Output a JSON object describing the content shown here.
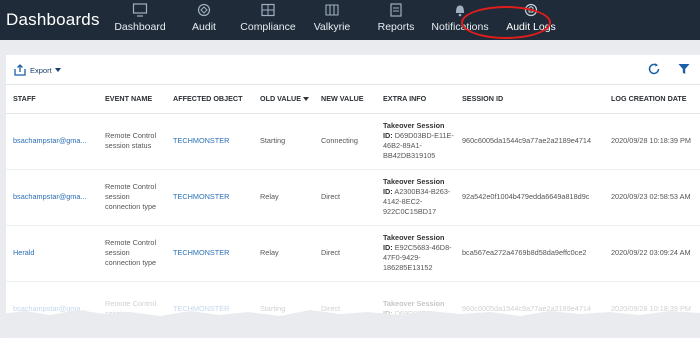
{
  "app": {
    "title": "Dashboards"
  },
  "nav": [
    {
      "label": "Dashboard",
      "icon": "monitor-icon"
    },
    {
      "label": "Audit",
      "icon": "audit-icon"
    },
    {
      "label": "Compliance",
      "icon": "compliance-icon"
    },
    {
      "label": "Valkyrie",
      "icon": "valkyrie-icon"
    },
    {
      "label": "Reports",
      "icon": "reports-icon"
    },
    {
      "label": "Notifications",
      "icon": "bell-icon"
    },
    {
      "label": "Audit Logs",
      "icon": "audit-logs-icon"
    }
  ],
  "toolbar": {
    "export_label": "Export"
  },
  "table": {
    "headers": [
      "STAFF",
      "EVENT NAME",
      "AFFECTED OBJECT",
      "OLD VALUE",
      "NEW VALUE",
      "EXTRA INFO",
      "SESSION ID",
      "LOG CREATION DATE"
    ],
    "rows": [
      {
        "staff": "bsachampstar@gma...",
        "event": "Remote Control session status",
        "object": "TECHMONSTER",
        "old": "Starting",
        "new": "Connecting",
        "extra_title": "Takeover Session",
        "extra_id_label": "ID:",
        "extra_id": "D69D03BD-E11E-46B2-89A1-BB42DB319105",
        "session": "960c6005da1544c9a77ae2a2189e4714",
        "date": "2020/09/28 10:18:39 PM"
      },
      {
        "staff": "bsachampstar@gma...",
        "event": "Remote Control session connection type",
        "object": "TECHMONSTER",
        "old": "Relay",
        "new": "Direct",
        "extra_title": "Takeover Session",
        "extra_id_label": "ID:",
        "extra_id": "A2300B34-B263-4142-8EC2-922C0C15BD17",
        "session": "92a542e0f1004b479edda6649a818d9c",
        "date": "2020/09/23 02:58:53 AM"
      },
      {
        "staff": "Herald",
        "event": "Remote Control session connection type",
        "object": "TECHMONSTER",
        "old": "Relay",
        "new": "Direct",
        "extra_title": "Takeover Session",
        "extra_id_label": "ID:",
        "extra_id": "E92C5683-46D8-47F0-9429-186285E13152",
        "session": "bca567ea272a4769b8d58da9effc0ce2",
        "date": "2020/09/22 03:09:24 AM"
      },
      {
        "staff": "bsachampstar@gma...",
        "event": "Remote Control session",
        "object": "TECHMONSTER",
        "old": "Starting",
        "new": "Direct",
        "extra_title": "Takeover Session",
        "extra_id_label": "ID:",
        "extra_id": "D69D03BD-",
        "session": "960c6005da1544c9a77ae2a2189e4714",
        "date": "2020/09/28 10:18:39 PM"
      }
    ]
  },
  "colors": {
    "topbar": "#1f2b38",
    "link": "#2a6fb3",
    "highlight": "#e01d1d",
    "accent": "#1a5fa8"
  }
}
